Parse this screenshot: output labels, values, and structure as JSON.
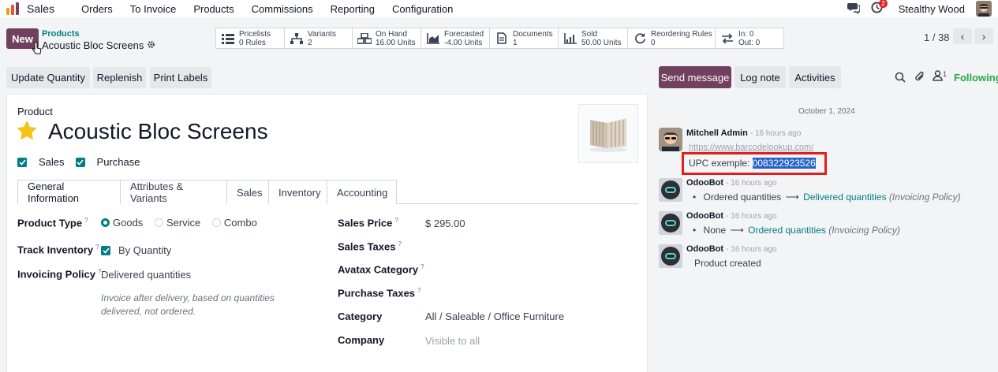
{
  "nav": {
    "app": "Sales",
    "items": [
      "Orders",
      "To Invoice",
      "Products",
      "Commissions",
      "Reporting",
      "Configuration"
    ],
    "activity_badge": "2",
    "user": "Stealthy Wood"
  },
  "control": {
    "new_label": "New",
    "breadcrumb_parent": "Products",
    "breadcrumb_current": "Acoustic Bloc Screens",
    "smart_buttons": [
      {
        "icon": "list-icon",
        "label": "Pricelists",
        "value": "0 Rules"
      },
      {
        "icon": "sitemap-icon",
        "label": "Variants",
        "value": "2"
      },
      {
        "icon": "cubes-icon",
        "label": "On Hand",
        "value": "16.00 Units"
      },
      {
        "icon": "area-chart-icon",
        "label": "Forecasted",
        "value": "-4.00 Units"
      },
      {
        "icon": "document-icon",
        "label": "Documents",
        "value": "1"
      },
      {
        "icon": "bar-chart-icon",
        "label": "Sold",
        "value": "50.00 Units"
      },
      {
        "icon": "refresh-icon",
        "label": "Reordering Rules",
        "value": "0"
      },
      {
        "icon": "exchange-icon",
        "label": "In: 0",
        "value": "Out: 0"
      }
    ],
    "pager": "1 / 38"
  },
  "actions": {
    "update_quantity": "Update Quantity",
    "replenish": "Replenish",
    "print_labels": "Print Labels"
  },
  "form": {
    "product_label": "Product",
    "name": "Acoustic Bloc Screens",
    "sales_check": "Sales",
    "purchase_check": "Purchase",
    "tabs": [
      "General Information",
      "Attributes & Variants",
      "Sales",
      "Inventory",
      "Accounting"
    ],
    "product_type_label": "Product Type",
    "product_type_options": [
      "Goods",
      "Service",
      "Combo"
    ],
    "track_inventory_label": "Track Inventory",
    "track_inventory_value": "By Quantity",
    "invoicing_policy_label": "Invoicing Policy",
    "invoicing_policy_value": "Delivered quantities",
    "invoicing_help": "Invoice after delivery, based on quantities delivered, not ordered.",
    "sales_price_label": "Sales Price",
    "sales_price_value": "$ 295.00",
    "sales_taxes_label": "Sales Taxes",
    "avatax_label": "Avatax Category",
    "purchase_taxes_label": "Purchase Taxes",
    "category_label": "Category",
    "category_value": "All / Saleable / Office Furniture",
    "company_label": "Company",
    "company_value": "Visible to all",
    "help_mark": "?"
  },
  "chatter": {
    "send_message": "Send message",
    "log_note": "Log note",
    "activities": "Activities",
    "follower_count": "1",
    "following": "Following",
    "date": "October 1, 2024",
    "messages": [
      {
        "author": "Mitchell Admin",
        "time": "- 16 hours ago",
        "link": "https://www.barcodelookup.com/",
        "body_label": "UPC exemple: ",
        "body_value": "008322923526"
      },
      {
        "author": "OdooBot",
        "time": "- 16 hours ago",
        "old": "Ordered quantities",
        "new": "Delivered quantities",
        "field": "(Invoicing Policy)"
      },
      {
        "author": "OdooBot",
        "time": "- 16 hours ago",
        "old": "None",
        "new": "Ordered quantities",
        "field": "(Invoicing Policy)"
      },
      {
        "author": "OdooBot",
        "time": "- 16 hours ago",
        "body": "Product created"
      }
    ]
  },
  "colors": {
    "primary": "#71405f",
    "teal": "#017e84",
    "highlight_box": "#e11d1d",
    "selection": "#2463c9",
    "star": "#f3c318"
  }
}
